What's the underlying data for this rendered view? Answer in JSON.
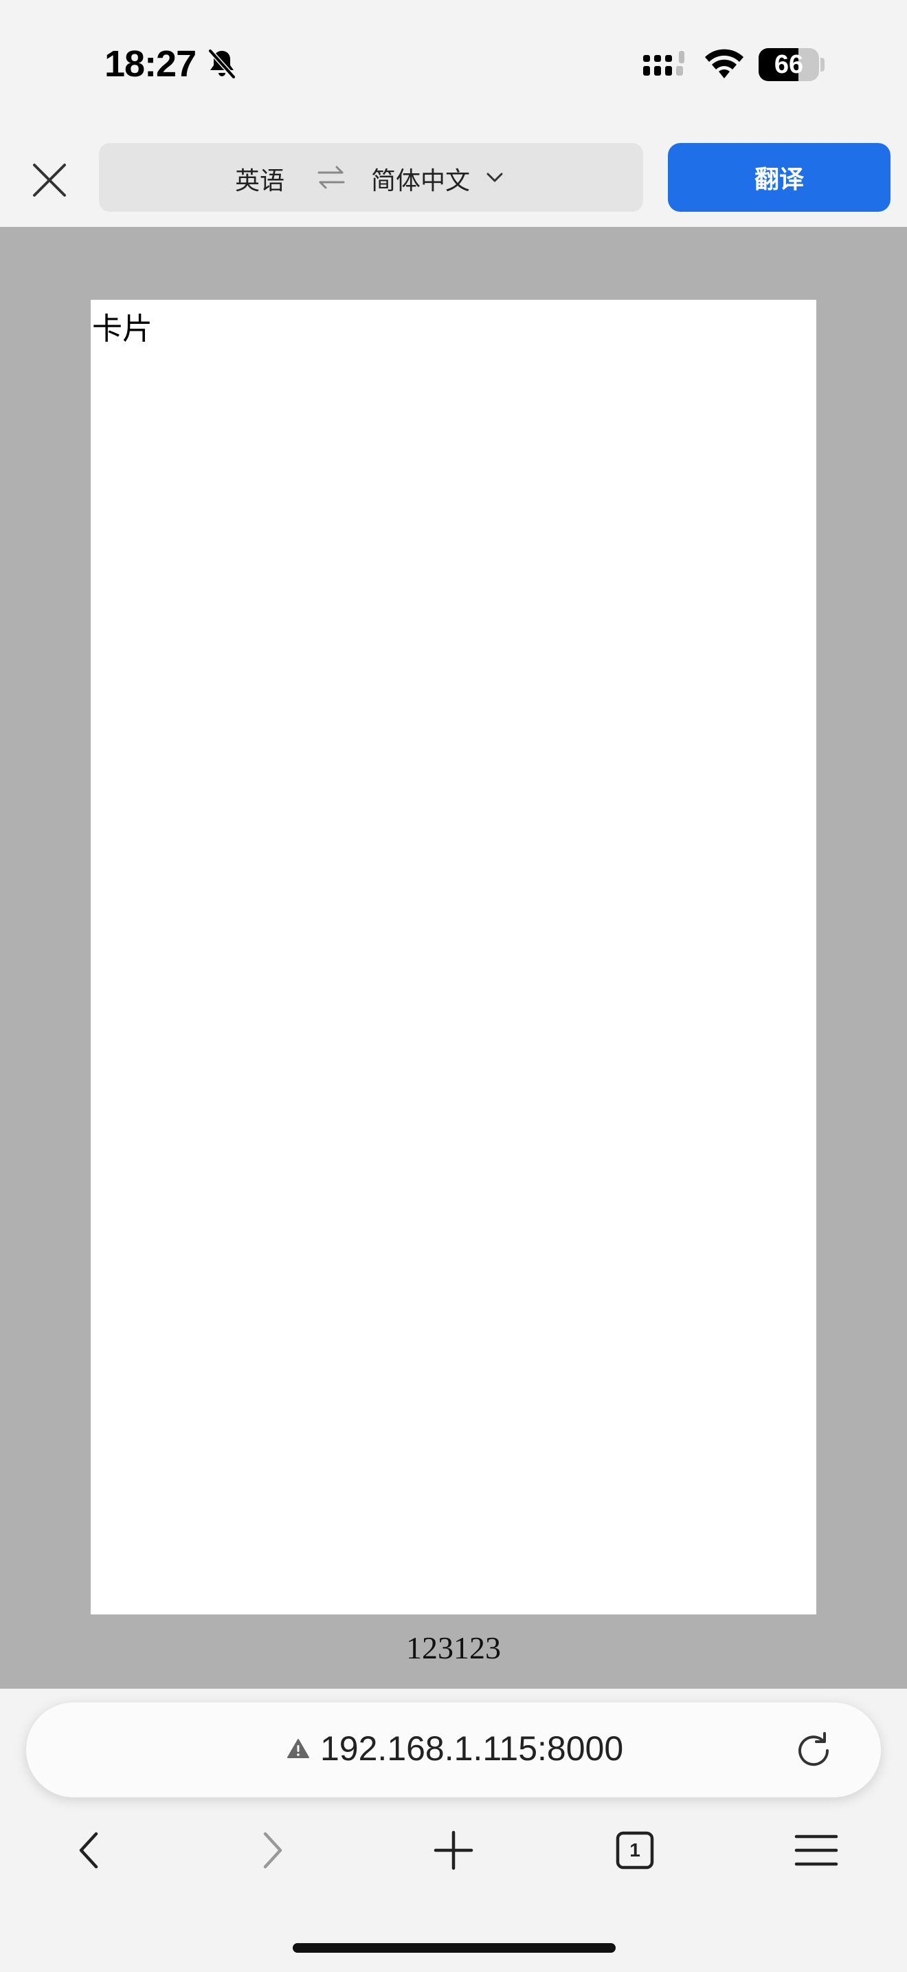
{
  "status_bar": {
    "time": "18:27",
    "battery": "66",
    "battery_level": 0.66
  },
  "translate_bar": {
    "source_language": "英语",
    "target_language": "简体中文",
    "translate_label": "翻译"
  },
  "page": {
    "card_title": "卡片",
    "page_number": "123123"
  },
  "address_bar": {
    "url": "192.168.1.115:8000"
  },
  "toolbar": {
    "tab_count": "1"
  },
  "colors": {
    "accent": "#1f6fe8",
    "viewport_background": "#b0b0b0",
    "chrome_background": "#f3f3f3"
  }
}
